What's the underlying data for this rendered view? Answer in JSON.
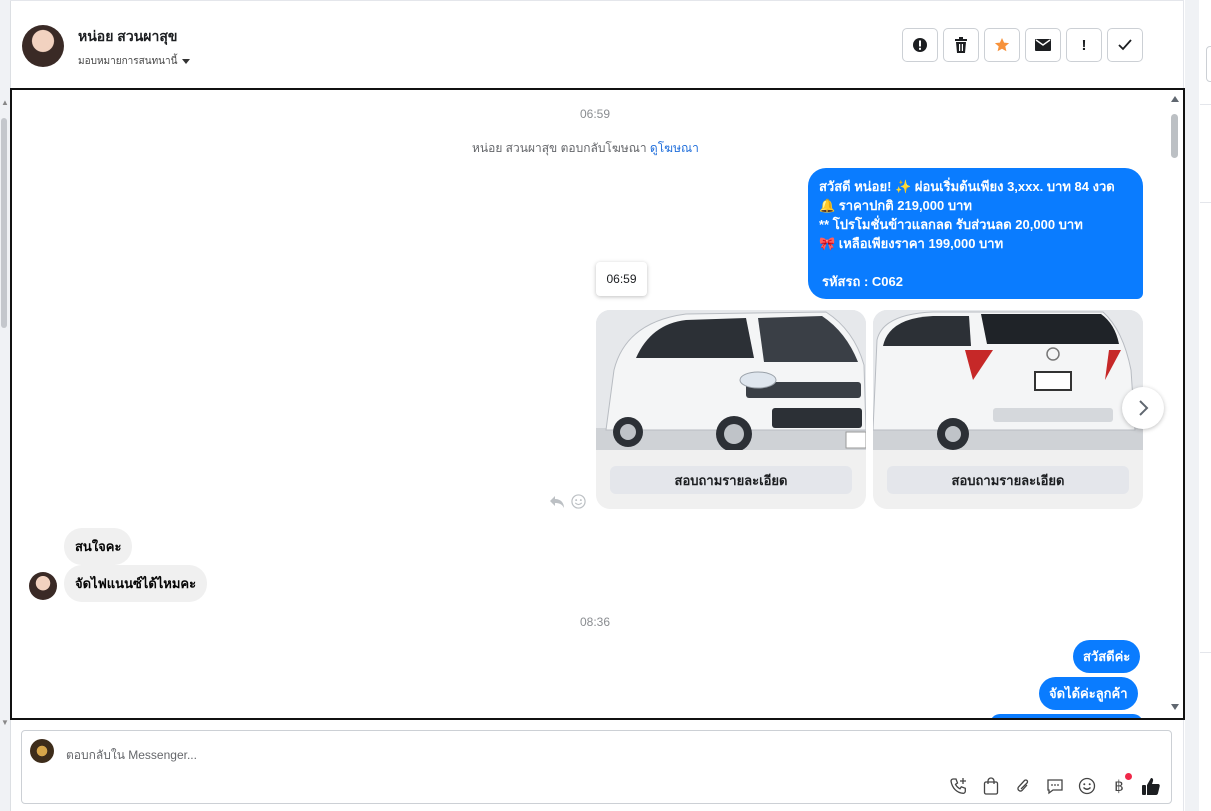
{
  "header": {
    "contact_name": "หน่อย สวนผาสุข",
    "assign_label": "มอบหมายการสนทนานี้",
    "actions": [
      {
        "name": "spam",
        "label": "!"
      },
      {
        "name": "delete",
        "label": "🗑"
      },
      {
        "name": "star",
        "label": "★"
      },
      {
        "name": "mark-unread",
        "label": "✉"
      },
      {
        "name": "follow-up",
        "label": "!"
      },
      {
        "name": "done",
        "label": "✓"
      }
    ]
  },
  "conversation": {
    "timestamp_1": "06:59",
    "reply_info": {
      "text": "หน่อย สวนผาสุข ตอบกลับโฆษณา",
      "link": "ดูโฆษณา"
    },
    "ad_message_lines": [
      "สวัสดี หน่อย! ✨  ผ่อนเริ่มต้นเพียง 3,xxx. บาท 84 งวด",
      "🔔 ราคาปกติ 219,000 บาท",
      "** โปรโมชั่นข้าวแลกลด รับส่วนลด 20,000 บาท",
      "🎀  เหลือเพียงราคา 199,000 บาท",
      "",
      "รหัสรถ : C062"
    ],
    "tooltip_time": "06:59",
    "cards": [
      {
        "button": "สอบถามรายละเอียด"
      },
      {
        "button": "สอบถามรายละเอียด"
      }
    ],
    "incoming": [
      "สนใจคะ",
      "จัดไฟแนนซ์ได้ไหมคะ"
    ],
    "timestamp_2": "08:36",
    "outgoing": [
      "สวัสดีค่ะ",
      "จัดได้ค่ะลูกค้า"
    ]
  },
  "composer": {
    "placeholder": "ตอบกลับใน Messenger..."
  },
  "colors": {
    "accent": "#0a7cff",
    "star": "#f7923b",
    "notification_dot": "#f02849"
  }
}
